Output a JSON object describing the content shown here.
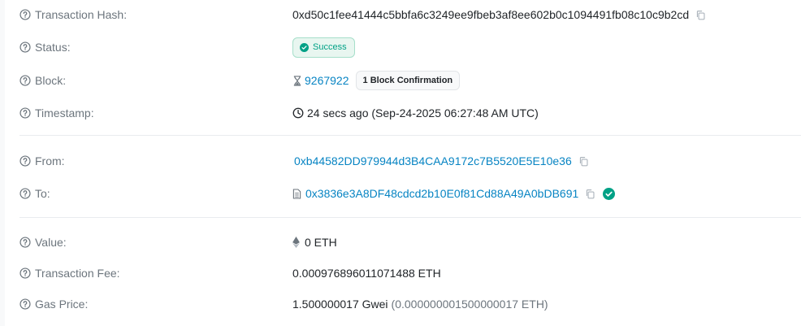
{
  "rows": {
    "tx_hash": {
      "label": "Transaction Hash:",
      "value": "0xd50c1fee41444c5bbfa6c3249ee9fbeb3af8ee602b0c1094491fb08c10c9b2cd"
    },
    "status": {
      "label": "Status:",
      "value": "Success"
    },
    "block": {
      "label": "Block:",
      "value": "9267922",
      "confirmations": "1 Block Confirmation"
    },
    "timestamp": {
      "label": "Timestamp:",
      "value": "24 secs ago (Sep-24-2025 06:27:48 AM UTC)"
    },
    "from": {
      "label": "From:",
      "value": "0xb44582DD979944d3B4CAA9172c7B5520E5E10e36"
    },
    "to": {
      "label": "To:",
      "value": "0x3836e3A8DF48cdcd2b10E0f81Cd88A49A0bDB691"
    },
    "value": {
      "label": "Value:",
      "value": "0 ETH"
    },
    "fee": {
      "label": "Transaction Fee:",
      "value": "0.000976896011071488 ETH"
    },
    "gas_price": {
      "label": "Gas Price:",
      "value_gwei": "1.500000017 Gwei",
      "value_eth": "(0.000000001500000017 ETH)"
    }
  },
  "icons": {
    "help": "question-circle-icon",
    "copy": "copy-icon",
    "success": "check-circle-icon",
    "pending": "hourglass-icon",
    "clock": "clock-icon",
    "contract": "file-icon",
    "verified": "verified-check-icon",
    "eth": "ethereum-icon"
  },
  "colors": {
    "link": "#0784c3",
    "success_text": "#00a186",
    "success_bg": "#e8f6f0",
    "label": "#6c757d"
  }
}
